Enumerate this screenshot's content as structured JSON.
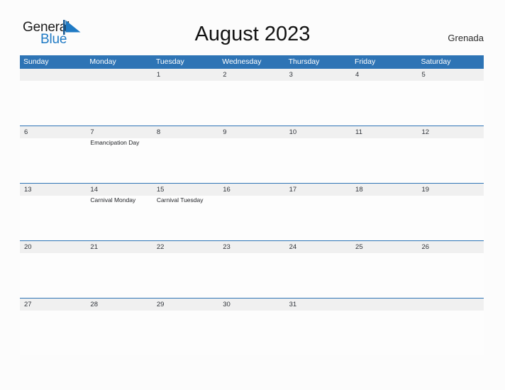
{
  "brand": {
    "name_part1": "General",
    "name_part2": "Blue",
    "flag_icon": "blue-flag-triangle",
    "accent_color": "#1f7ac4"
  },
  "header": {
    "title": "August 2023",
    "region": "Grenada"
  },
  "theme": {
    "header_blue": "#2e74b5",
    "daynum_band": "#f0f0f0",
    "page_background": "#fcfcfc",
    "text_color": "#30343a"
  },
  "calendar": {
    "month": "August",
    "year": "2023",
    "weekday_headers": [
      "Sunday",
      "Monday",
      "Tuesday",
      "Wednesday",
      "Thursday",
      "Friday",
      "Saturday"
    ],
    "weeks": [
      {
        "days": [
          {
            "num": "",
            "event": ""
          },
          {
            "num": "",
            "event": ""
          },
          {
            "num": "1",
            "event": ""
          },
          {
            "num": "2",
            "event": ""
          },
          {
            "num": "3",
            "event": ""
          },
          {
            "num": "4",
            "event": ""
          },
          {
            "num": "5",
            "event": ""
          }
        ]
      },
      {
        "days": [
          {
            "num": "6",
            "event": ""
          },
          {
            "num": "7",
            "event": "Emancipation Day"
          },
          {
            "num": "8",
            "event": ""
          },
          {
            "num": "9",
            "event": ""
          },
          {
            "num": "10",
            "event": ""
          },
          {
            "num": "11",
            "event": ""
          },
          {
            "num": "12",
            "event": ""
          }
        ]
      },
      {
        "days": [
          {
            "num": "13",
            "event": ""
          },
          {
            "num": "14",
            "event": "Carnival Monday"
          },
          {
            "num": "15",
            "event": "Carnival Tuesday"
          },
          {
            "num": "16",
            "event": ""
          },
          {
            "num": "17",
            "event": ""
          },
          {
            "num": "18",
            "event": ""
          },
          {
            "num": "19",
            "event": ""
          }
        ]
      },
      {
        "days": [
          {
            "num": "20",
            "event": ""
          },
          {
            "num": "21",
            "event": ""
          },
          {
            "num": "22",
            "event": ""
          },
          {
            "num": "23",
            "event": ""
          },
          {
            "num": "24",
            "event": ""
          },
          {
            "num": "25",
            "event": ""
          },
          {
            "num": "26",
            "event": ""
          }
        ]
      },
      {
        "days": [
          {
            "num": "27",
            "event": ""
          },
          {
            "num": "28",
            "event": ""
          },
          {
            "num": "29",
            "event": ""
          },
          {
            "num": "30",
            "event": ""
          },
          {
            "num": "31",
            "event": ""
          },
          {
            "num": "",
            "event": ""
          },
          {
            "num": "",
            "event": ""
          }
        ]
      }
    ]
  }
}
